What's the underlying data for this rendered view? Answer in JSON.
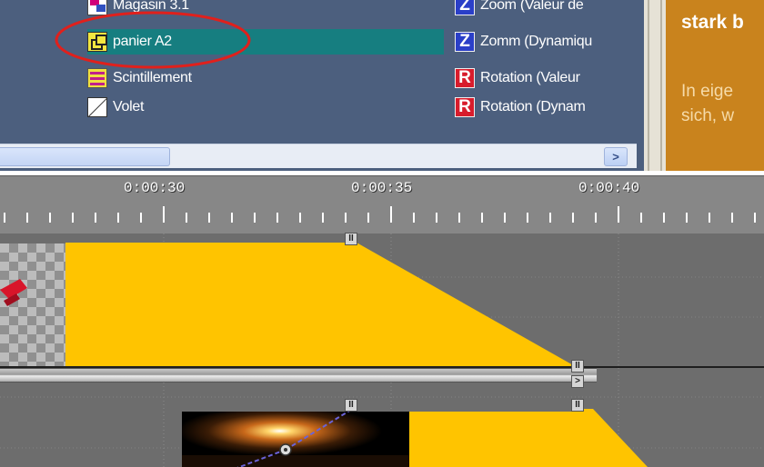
{
  "browser": {
    "items_left": [
      {
        "label": "Magasin 3.1",
        "icon": "magasin-icon"
      },
      {
        "label": "panier A2",
        "icon": "panier-icon",
        "selected": true
      },
      {
        "label": "Scintillement",
        "icon": "scintillement-icon"
      },
      {
        "label": "Volet",
        "icon": "volet-icon"
      }
    ],
    "items_right": [
      {
        "label": "Zoom (Valeur de",
        "letter": "Z"
      },
      {
        "label": "Zomm (Dynamiqu",
        "letter": "Z"
      },
      {
        "label": "Rotation (Valeur",
        "letter": "R"
      },
      {
        "label": "Rotation (Dynam",
        "letter": "R"
      }
    ],
    "scroll_right_glyph": ">"
  },
  "info_panel": {
    "title": "stark b",
    "text_line1": "In eige",
    "text_line2": "sich, w"
  },
  "timeline": {
    "time_labels": [
      "0:00:30",
      "0:00:35",
      "0:00:40"
    ],
    "handle_glyph": "II",
    "marker_glyph": ">"
  },
  "colors": {
    "panel_bg": "#4c5f7e",
    "selected_row": "#167e80",
    "info_bg": "#c9831d",
    "clip_yellow": "#ffc400",
    "annotation_red": "#e0201c"
  }
}
